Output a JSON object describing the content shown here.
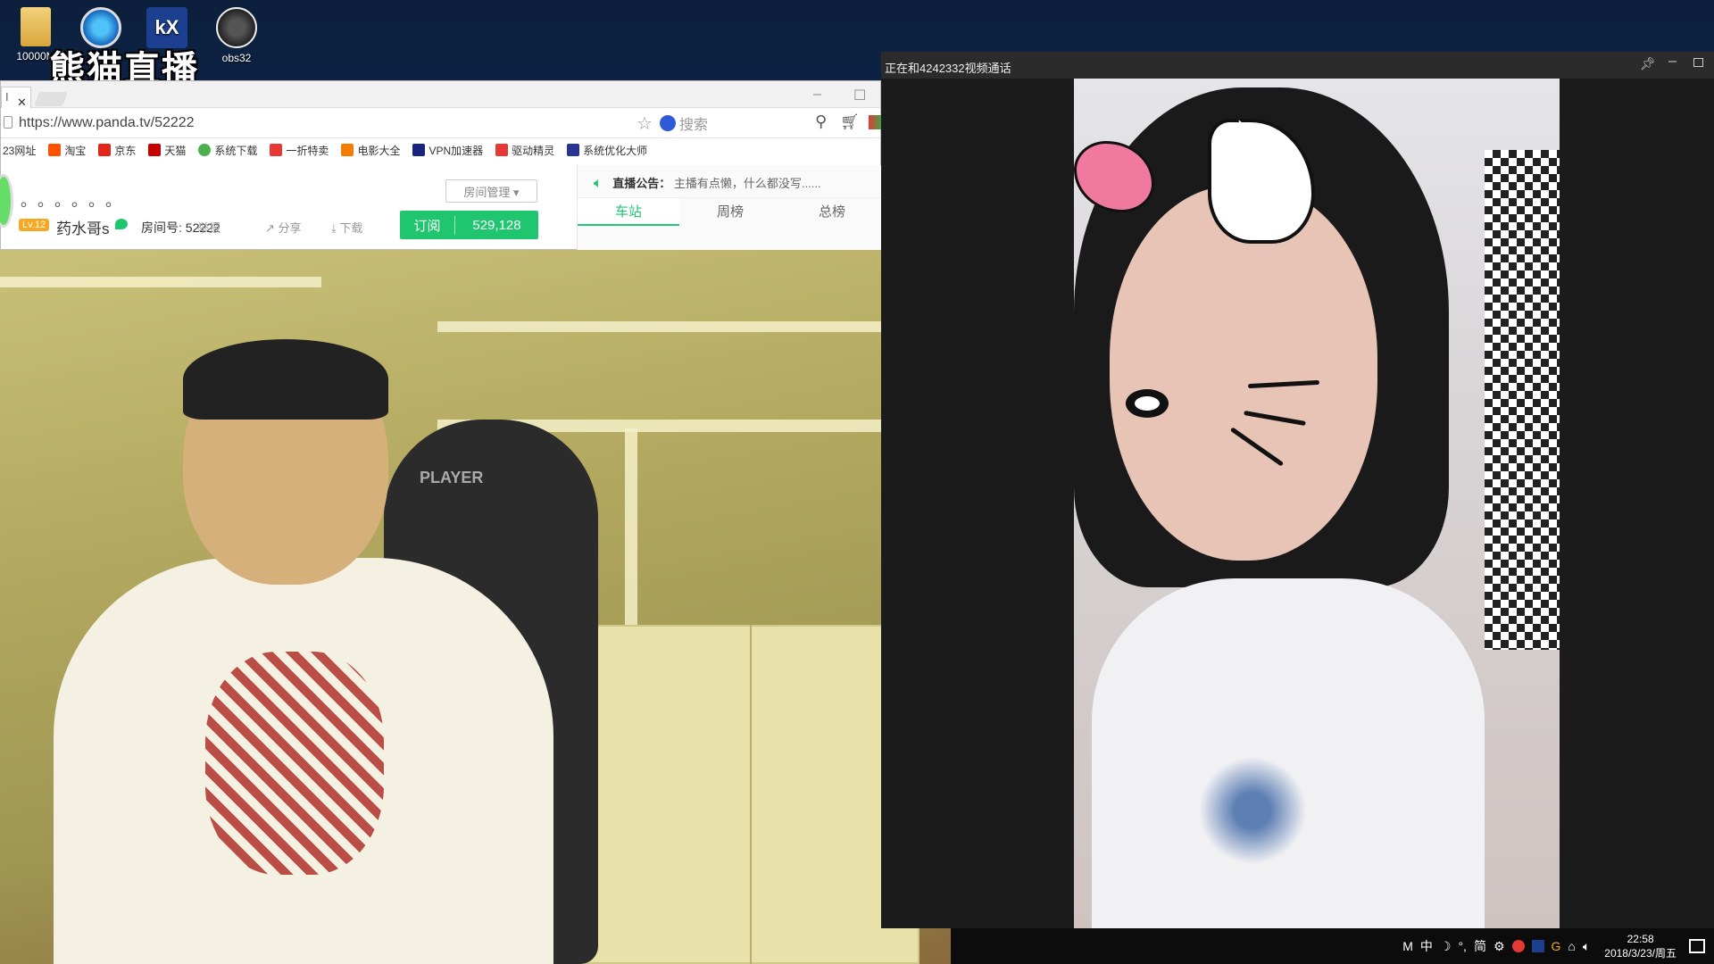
{
  "desktop": {
    "icons": [
      {
        "label": "10000M",
        "icon": "folder-icon"
      },
      {
        "label": "",
        "icon": "gear-app-icon"
      },
      {
        "label": "",
        "icon": "kx-app-icon"
      },
      {
        "label": "obs32",
        "icon": "obs-icon"
      }
    ],
    "logo_text": "熊猫直播"
  },
  "browser": {
    "tab_partial": "I",
    "url": "https://www.panda.tv/52222",
    "search_placeholder": "搜索",
    "bookmarks": [
      {
        "label": "23网址",
        "color": ""
      },
      {
        "label": "淘宝",
        "color": "#ff5000"
      },
      {
        "label": "京东",
        "color": "#e1251b"
      },
      {
        "label": "天猫",
        "color": "#c40000"
      },
      {
        "label": "系统下载",
        "color": "#4caf50"
      },
      {
        "label": "一折特卖",
        "color": "#e53935"
      },
      {
        "label": "电影大全",
        "color": "#f57c00"
      },
      {
        "label": "VPN加速器",
        "color": "#1a237e"
      },
      {
        "label": "驱动精灵",
        "color": "#e53935"
      },
      {
        "label": "系统优化大师",
        "color": "#283593"
      }
    ]
  },
  "room": {
    "dots": "。。。。。。",
    "manage_label": "房间管理 ▾",
    "level": "Lv.12",
    "host_name": "药水哥s",
    "room_id": "房间号: 52222",
    "report_label": "举报",
    "share_label": "分享",
    "download_label": "下载",
    "subscribe_label": "订阅",
    "subscribe_count": "529,128",
    "notice_title": "直播公告：",
    "notice_text": "主播有点懒，什么都没写......",
    "tabs": [
      "车站",
      "周榜",
      "总榜"
    ]
  },
  "stream": {
    "chair_text": "PLAYER"
  },
  "call": {
    "title": "正在和4242332视频通话"
  },
  "taskbar": {
    "tray_items": [
      "M",
      "中",
      "☽",
      "°,",
      "简",
      "⚙"
    ],
    "time": "22:58",
    "date": "2018/3/23/周五"
  }
}
